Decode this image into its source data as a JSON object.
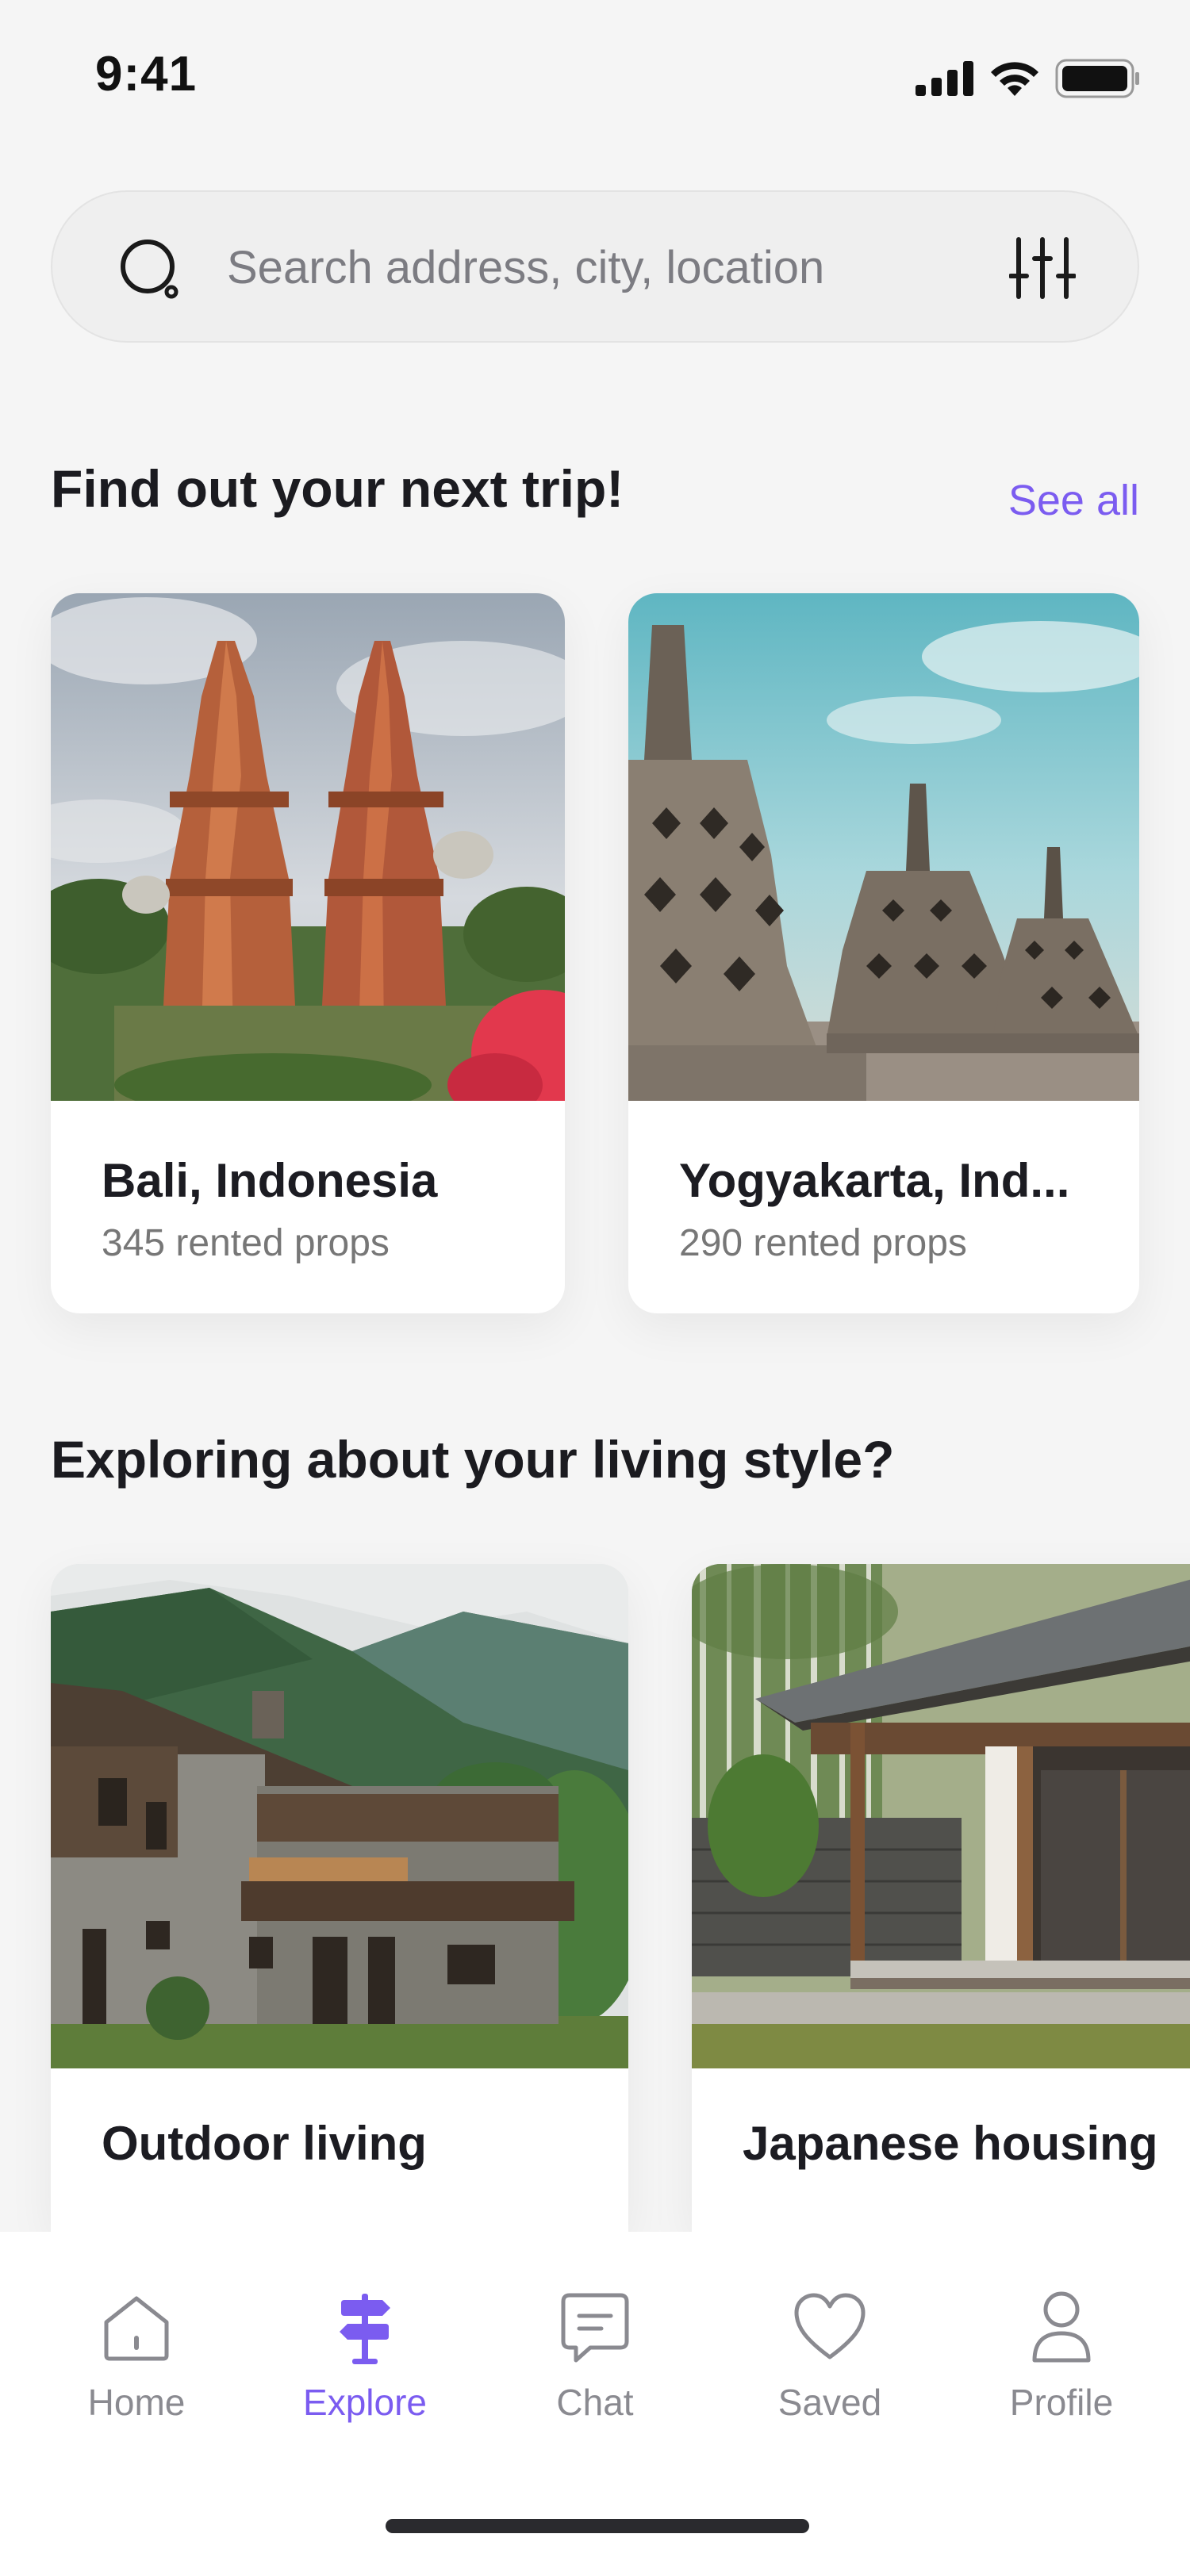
{
  "status_bar": {
    "time": "9:41"
  },
  "search": {
    "placeholder": "Search address, city, location"
  },
  "trips_section": {
    "title": "Find out your next trip!",
    "see_all": "See all",
    "cards": [
      {
        "title": "Bali, Indonesia",
        "subtitle": "345 rented props"
      },
      {
        "title": "Yogyakarta, Ind...",
        "subtitle": "290 rented props"
      }
    ]
  },
  "styles_section": {
    "title": "Exploring about your living style?",
    "cards": [
      {
        "title": "Outdoor living"
      },
      {
        "title": "Japanese housing"
      }
    ]
  },
  "tab_bar": {
    "items": [
      {
        "label": "Home",
        "icon": "home-icon",
        "active": false
      },
      {
        "label": "Explore",
        "icon": "signpost-icon",
        "active": true
      },
      {
        "label": "Chat",
        "icon": "chat-icon",
        "active": false
      },
      {
        "label": "Saved",
        "icon": "heart-icon",
        "active": false
      },
      {
        "label": "Profile",
        "icon": "user-icon",
        "active": false
      }
    ]
  },
  "colors": {
    "accent": "#7b5cf0",
    "background": "#f5f5f5",
    "card": "#ffffff"
  }
}
